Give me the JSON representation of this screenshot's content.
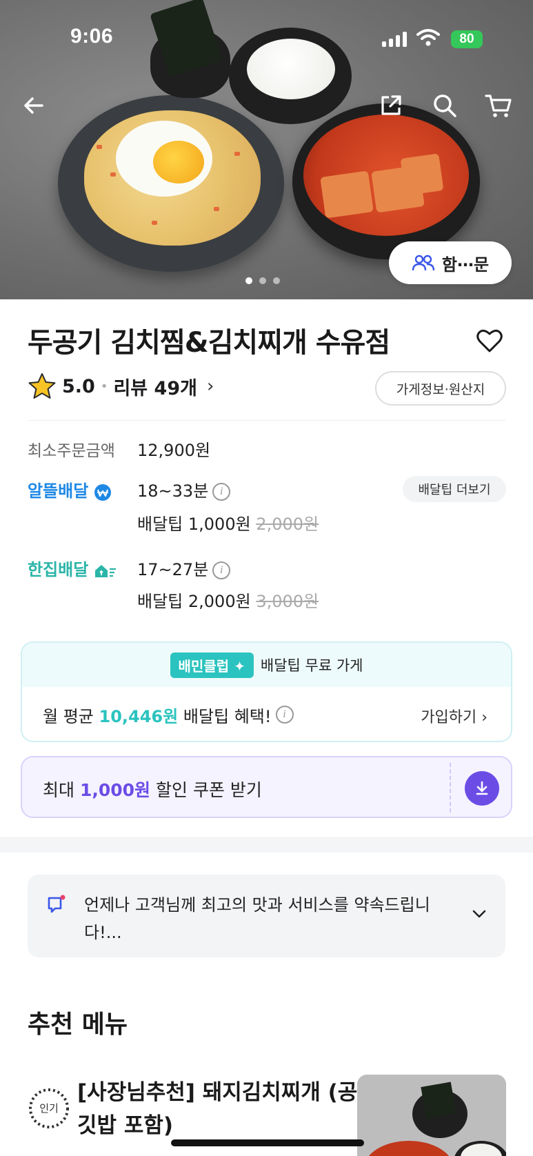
{
  "status_bar": {
    "time": "9:06",
    "battery": "80"
  },
  "hero": {
    "group_order_label": "함⋯문",
    "carousel_dots": 3,
    "carousel_active": 0
  },
  "store": {
    "name": "두공기 김치찜&김치찌개 수유점",
    "rating": "5.0",
    "review_label": "리뷰 49개",
    "info_button": "가게정보·원산지"
  },
  "order_info": {
    "min_order_label": "최소주문금액",
    "min_order_value": "12,900원",
    "alttul": {
      "label": "알뜰배달",
      "time": "18~33분",
      "tip_label": "배달팁",
      "tip": "1,000원",
      "tip_original": "2,000원"
    },
    "hanjib": {
      "label": "한집배달",
      "time": "17~27분",
      "tip_label": "배달팁",
      "tip": "2,000원",
      "tip_original": "3,000원"
    },
    "tip_more_button": "배달팁 더보기"
  },
  "club": {
    "badge": "배민클럽",
    "headline": "배달팁 무료 가게",
    "benefit_prefix": "월 평균",
    "benefit_amount": "10,446원",
    "benefit_suffix": "배달팁 혜택!",
    "join_label": "가입하기"
  },
  "coupon": {
    "prefix": "최대",
    "amount": "1,000원",
    "suffix": "할인 쿠폰 받기"
  },
  "notice": {
    "text": "언제나 고객님께 최고의 맛과 서비스를 약속드립니다!..."
  },
  "recommended": {
    "title": "추천 메뉴",
    "items": [
      {
        "badge": "인기",
        "name": "[사장님추천] 돼지김치찌개 (공깃밥 포함)"
      }
    ]
  },
  "colors": {
    "alttul_blue": "#1e88e5",
    "hanjib_teal": "#2bb5a8",
    "club_teal": "#2bc3bf",
    "coupon_purple": "#6b4de6",
    "battery_green": "#34c759"
  }
}
